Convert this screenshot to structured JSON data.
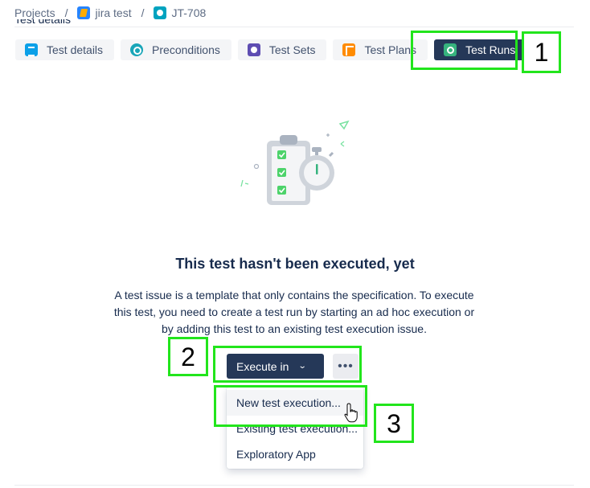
{
  "breadcrumb": {
    "projects": "Projects",
    "separator": "/",
    "project": "jira test",
    "issue_key": "JT-708"
  },
  "section_label": "Test details",
  "tabs": [
    {
      "label": "Test details",
      "icon": "list-icon",
      "color": "#0ba0e8"
    },
    {
      "label": "Preconditions",
      "icon": "precondition-icon",
      "color": "#18a5b8"
    },
    {
      "label": "Test Sets",
      "icon": "test-sets-icon",
      "color": "#5e4db2"
    },
    {
      "label": "Test Plans",
      "icon": "test-plans-icon",
      "color": "#ff8b00"
    },
    {
      "label": "Test Runs",
      "icon": "test-runs-icon",
      "color": "#36b37e",
      "active": true
    }
  ],
  "empty_state": {
    "title": "This test hasn't been executed, yet",
    "description": "A test issue is a template that only contains the specification. To execute this test, you need to create a test run by starting an ad hoc execution or by adding this test to an existing test execution issue."
  },
  "actions": {
    "execute_label": "Execute in",
    "more_label": "•••"
  },
  "dropdown": {
    "items": [
      "New test execution...",
      "Existing test execution...",
      "Exploratory App"
    ]
  },
  "annotations": {
    "one": "1",
    "two": "2",
    "three": "3",
    "highlight_color": "#22e51c"
  }
}
